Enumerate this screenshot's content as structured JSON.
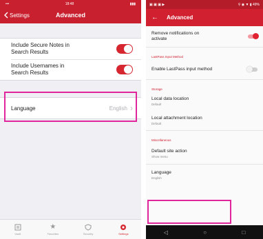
{
  "ios": {
    "status": {
      "left": "•••",
      "time": "18:48",
      "right": "▮▮▮"
    },
    "nav": {
      "back_label": "Settings",
      "title": "Advanced"
    },
    "toggles": [
      {
        "label_line1": "Include Secure Notes in",
        "label_line2": "Search Results",
        "on": true
      },
      {
        "label_line1": "Include Usernames in",
        "label_line2": "Search Results",
        "on": true
      }
    ],
    "language": {
      "label": "Language",
      "value": "English"
    },
    "tabs": [
      {
        "icon": "vault-icon",
        "label": "Vault"
      },
      {
        "icon": "star-icon",
        "label": "Favorites"
      },
      {
        "icon": "shield-icon",
        "label": "Security"
      },
      {
        "icon": "gear-icon",
        "label": "Settings",
        "active": true
      }
    ],
    "colors": {
      "brand": "#c8202f",
      "highlight": "#e0249b"
    }
  },
  "android": {
    "status": {
      "left": "▣ ▣ ▣ ▶",
      "right": "⚲ ◉ ▼ ▮ 49%"
    },
    "appbar": {
      "title": "Advanced"
    },
    "items": {
      "remove_notifications": {
        "line1": "Remove notifications on",
        "line2": "activate",
        "toggle_on": true
      },
      "section_input": "LastPass Input Method",
      "enable_input": {
        "label": "Enable LastPass input method",
        "toggle_on": false
      },
      "section_storage": "Storage",
      "local_data": {
        "title": "Local data location",
        "subtitle": "Default"
      },
      "local_attachment": {
        "title": "Local attachment location",
        "subtitle": "Default"
      },
      "section_misc": "Miscellaneous",
      "default_site_action": {
        "title": "Default site action",
        "subtitle": "Show menu"
      },
      "language": {
        "title": "Language",
        "subtitle": "English"
      }
    },
    "navbar": {
      "back": "◁",
      "home": "○",
      "recents": "□"
    },
    "colors": {
      "brand": "#d1202f",
      "highlight": "#e0249b"
    }
  }
}
